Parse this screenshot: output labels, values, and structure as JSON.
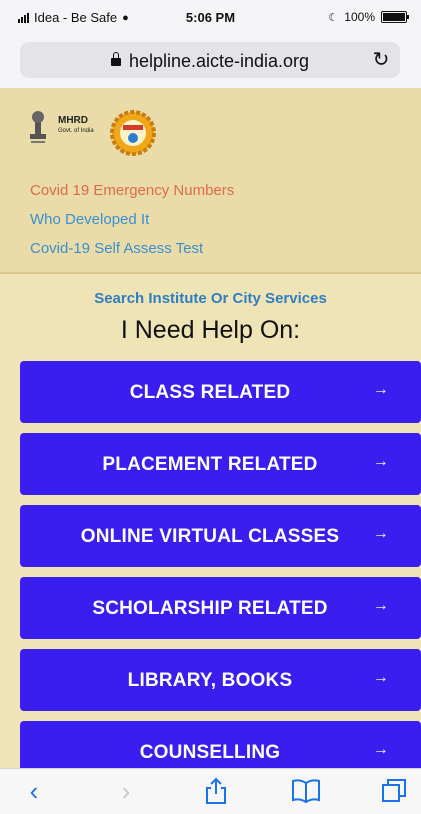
{
  "status_bar": {
    "carrier": "Idea - Be Safe",
    "time": "5:06 PM",
    "battery": "100%"
  },
  "browser": {
    "url": "helpline.aicte-india.org"
  },
  "header": {
    "logo_text": "MHRD",
    "logo_subtext": "Govt. of India",
    "links": [
      "Covid 19 Emergency Numbers",
      "Who Developed It",
      "Covid-19 Self Assess Test"
    ]
  },
  "help": {
    "search_link": "Search Institute Or City Services",
    "heading": "I Need Help On:",
    "arrow": "→",
    "items": [
      "CLASS RELATED",
      "PLACEMENT RELATED",
      "ONLINE VIRTUAL CLASSES",
      "SCHOLARSHIP RELATED",
      "LIBRARY, BOOKS",
      "COUNSELLING"
    ]
  },
  "colors": {
    "button": "#3a1ef0",
    "background": "#efe4b6",
    "header": "#e9dca8",
    "link_red": "#e06a4a",
    "link_blue": "#3b8fd0"
  },
  "toolbar_icons": [
    "back-icon",
    "forward-icon",
    "share-icon",
    "bookmarks-icon",
    "tabs-icon"
  ]
}
